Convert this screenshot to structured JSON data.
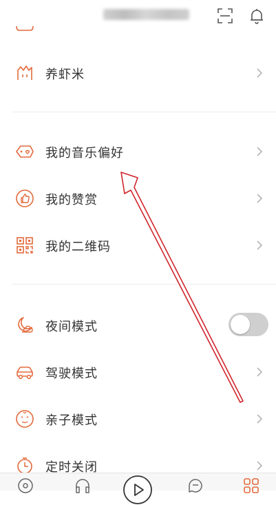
{
  "colors": {
    "accent": "#e36a3c",
    "text": "#333333",
    "chevron": "#b5b5b5",
    "toggle_off": "#cfcfcf",
    "annotation_arrow": "#d0242b"
  },
  "header": {
    "icons": [
      "scan-icon",
      "bell-icon"
    ]
  },
  "sections": [
    {
      "items": [
        {
          "label": "养虾米",
          "icon": "shrimp-icon",
          "control": "chevron"
        }
      ]
    },
    {
      "items": [
        {
          "label": "我的音乐偏好",
          "icon": "music-tag-icon",
          "control": "chevron"
        },
        {
          "label": "我的赞赏",
          "icon": "thumbs-up-icon",
          "control": "chevron"
        },
        {
          "label": "我的二维码",
          "icon": "qr-code-icon",
          "control": "chevron"
        }
      ]
    },
    {
      "items": [
        {
          "label": "夜间模式",
          "icon": "moon-cloud-icon",
          "control": "toggle",
          "toggle_on": false
        },
        {
          "label": "驾驶模式",
          "icon": "car-icon",
          "control": "chevron"
        },
        {
          "label": "亲子模式",
          "icon": "baby-face-icon",
          "control": "chevron"
        },
        {
          "label": "定时关闭",
          "icon": "timer-icon",
          "control": "chevron"
        }
      ]
    }
  ],
  "tabbar": {
    "icons": [
      "discover-icon",
      "headphones-icon",
      "play-icon",
      "message-icon",
      "my-grid-icon"
    ]
  }
}
